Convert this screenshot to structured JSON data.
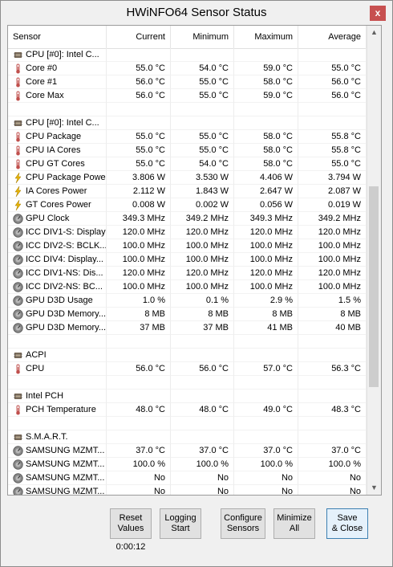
{
  "window": {
    "title": "HWiNFO64 Sensor Status",
    "close_label": "x"
  },
  "columns": {
    "sensor": "Sensor",
    "current": "Current",
    "minimum": "Minimum",
    "maximum": "Maximum",
    "average": "Average"
  },
  "rows": [
    {
      "type": "group",
      "icon": "cpu-chip-icon",
      "name": "CPU [#0]: Intel C..."
    },
    {
      "type": "sensor",
      "icon": "thermometer-icon",
      "name": "Core #0",
      "cur": "55.0 °C",
      "min": "54.0 °C",
      "max": "59.0 °C",
      "avg": "55.0 °C"
    },
    {
      "type": "sensor",
      "icon": "thermometer-icon",
      "name": "Core #1",
      "cur": "56.0 °C",
      "min": "55.0 °C",
      "max": "58.0 °C",
      "avg": "56.0 °C"
    },
    {
      "type": "sensor",
      "icon": "thermometer-icon",
      "name": "Core Max",
      "cur": "56.0 °C",
      "min": "55.0 °C",
      "max": "59.0 °C",
      "avg": "56.0 °C"
    },
    {
      "type": "blank"
    },
    {
      "type": "group",
      "icon": "cpu-chip-icon",
      "name": "CPU [#0]: Intel C..."
    },
    {
      "type": "sensor",
      "icon": "thermometer-icon",
      "name": "CPU Package",
      "cur": "55.0 °C",
      "min": "55.0 °C",
      "max": "58.0 °C",
      "avg": "55.8 °C"
    },
    {
      "type": "sensor",
      "icon": "thermometer-icon",
      "name": "CPU IA Cores",
      "cur": "55.0 °C",
      "min": "55.0 °C",
      "max": "58.0 °C",
      "avg": "55.8 °C"
    },
    {
      "type": "sensor",
      "icon": "thermometer-icon",
      "name": "CPU GT Cores",
      "cur": "55.0 °C",
      "min": "54.0 °C",
      "max": "58.0 °C",
      "avg": "55.0 °C"
    },
    {
      "type": "sensor",
      "icon": "lightning-icon",
      "name": "CPU Package Power",
      "cur": "3.806 W",
      "min": "3.530 W",
      "max": "4.406 W",
      "avg": "3.794 W"
    },
    {
      "type": "sensor",
      "icon": "lightning-icon",
      "name": "IA Cores Power",
      "cur": "2.112 W",
      "min": "1.843 W",
      "max": "2.647 W",
      "avg": "2.087 W"
    },
    {
      "type": "sensor",
      "icon": "lightning-icon",
      "name": "GT Cores Power",
      "cur": "0.008 W",
      "min": "0.002 W",
      "max": "0.056 W",
      "avg": "0.019 W"
    },
    {
      "type": "sensor",
      "icon": "gauge-icon",
      "name": "GPU Clock",
      "cur": "349.3 MHz",
      "min": "349.2 MHz",
      "max": "349.3 MHz",
      "avg": "349.2 MHz"
    },
    {
      "type": "sensor",
      "icon": "gauge-icon",
      "name": "ICC DIV1-S: Display",
      "cur": "120.0 MHz",
      "min": "120.0 MHz",
      "max": "120.0 MHz",
      "avg": "120.0 MHz"
    },
    {
      "type": "sensor",
      "icon": "gauge-icon",
      "name": "ICC DIV2-S: BCLK...",
      "cur": "100.0 MHz",
      "min": "100.0 MHz",
      "max": "100.0 MHz",
      "avg": "100.0 MHz"
    },
    {
      "type": "sensor",
      "icon": "gauge-icon",
      "name": "ICC DIV4: Display...",
      "cur": "100.0 MHz",
      "min": "100.0 MHz",
      "max": "100.0 MHz",
      "avg": "100.0 MHz"
    },
    {
      "type": "sensor",
      "icon": "gauge-icon",
      "name": "ICC DIV1-NS: Dis...",
      "cur": "120.0 MHz",
      "min": "120.0 MHz",
      "max": "120.0 MHz",
      "avg": "120.0 MHz"
    },
    {
      "type": "sensor",
      "icon": "gauge-icon",
      "name": "ICC DIV2-NS: BC...",
      "cur": "100.0 MHz",
      "min": "100.0 MHz",
      "max": "100.0 MHz",
      "avg": "100.0 MHz"
    },
    {
      "type": "sensor",
      "icon": "gauge-icon",
      "name": "GPU D3D Usage",
      "cur": "1.0 %",
      "min": "0.1 %",
      "max": "2.9 %",
      "avg": "1.5 %"
    },
    {
      "type": "sensor",
      "icon": "gauge-icon",
      "name": "GPU D3D Memory...",
      "cur": "8 MB",
      "min": "8 MB",
      "max": "8 MB",
      "avg": "8 MB"
    },
    {
      "type": "sensor",
      "icon": "gauge-icon",
      "name": "GPU D3D Memory...",
      "cur": "37 MB",
      "min": "37 MB",
      "max": "41 MB",
      "avg": "40 MB"
    },
    {
      "type": "blank"
    },
    {
      "type": "group",
      "icon": "cpu-chip-icon",
      "name": "ACPI"
    },
    {
      "type": "sensor",
      "icon": "thermometer-icon",
      "name": "CPU",
      "cur": "56.0 °C",
      "min": "56.0 °C",
      "max": "57.0 °C",
      "avg": "56.3 °C"
    },
    {
      "type": "blank"
    },
    {
      "type": "group",
      "icon": "cpu-chip-icon",
      "name": "Intel PCH"
    },
    {
      "type": "sensor",
      "icon": "thermometer-icon",
      "name": "PCH Temperature",
      "cur": "48.0 °C",
      "min": "48.0 °C",
      "max": "49.0 °C",
      "avg": "48.3 °C"
    },
    {
      "type": "blank"
    },
    {
      "type": "group",
      "icon": "cpu-chip-icon",
      "name": "S.M.A.R.T."
    },
    {
      "type": "sensor",
      "icon": "gauge-icon",
      "name": "SAMSUNG MZMT...",
      "cur": "37.0 °C",
      "min": "37.0 °C",
      "max": "37.0 °C",
      "avg": "37.0 °C"
    },
    {
      "type": "sensor",
      "icon": "gauge-icon",
      "name": "SAMSUNG MZMT...",
      "cur": "100.0 %",
      "min": "100.0 %",
      "max": "100.0 %",
      "avg": "100.0 %"
    },
    {
      "type": "sensor",
      "icon": "gauge-icon",
      "name": "SAMSUNG MZMT...",
      "cur": "No",
      "min": "No",
      "max": "No",
      "avg": "No"
    },
    {
      "type": "sensor",
      "icon": "gauge-icon",
      "name": "SAMSUNG MZMT...",
      "cur": "No",
      "min": "No",
      "max": "No",
      "avg": "No"
    }
  ],
  "buttons": [
    {
      "name": "reset-values-button",
      "line1": "Reset",
      "line2": "Values"
    },
    {
      "name": "logging-start-button",
      "line1": "Logging",
      "line2": "Start"
    },
    {
      "name": "configure-sensors-button",
      "line1": "Configure",
      "line2": "Sensors"
    },
    {
      "name": "minimize-all-button",
      "line1": "Minimize",
      "line2": "All"
    },
    {
      "name": "save-close-button",
      "line1": "Save",
      "line2": "& Close"
    }
  ],
  "timer": "0:00:12",
  "colors": {
    "thermometer": "#c0504d",
    "lightning": "#e8b400",
    "gauge": "#606060",
    "chip": "#7a6a58"
  }
}
